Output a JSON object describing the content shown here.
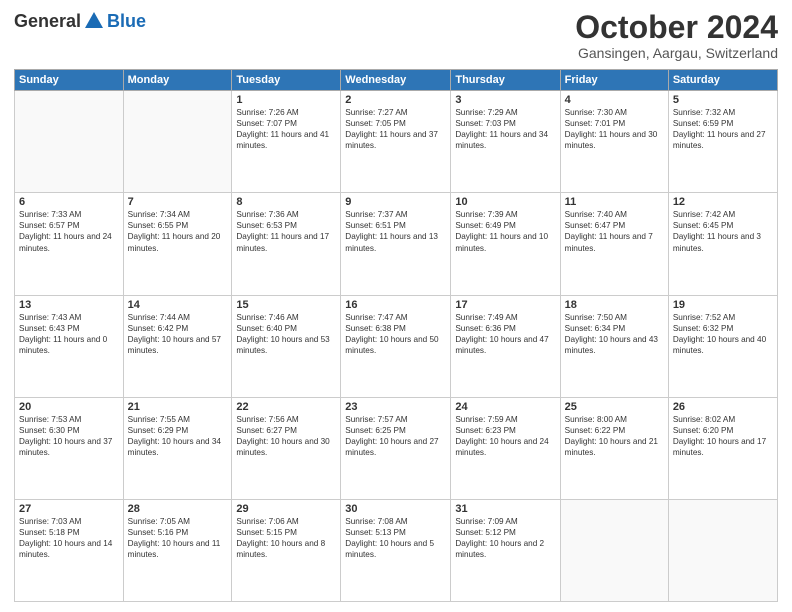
{
  "header": {
    "logo_general": "General",
    "logo_blue": "Blue",
    "month_title": "October 2024",
    "subtitle": "Gansingen, Aargau, Switzerland"
  },
  "days_of_week": [
    "Sunday",
    "Monday",
    "Tuesday",
    "Wednesday",
    "Thursday",
    "Friday",
    "Saturday"
  ],
  "weeks": [
    [
      {
        "day": "",
        "info": ""
      },
      {
        "day": "",
        "info": ""
      },
      {
        "day": "1",
        "info": "Sunrise: 7:26 AM\nSunset: 7:07 PM\nDaylight: 11 hours and 41 minutes."
      },
      {
        "day": "2",
        "info": "Sunrise: 7:27 AM\nSunset: 7:05 PM\nDaylight: 11 hours and 37 minutes."
      },
      {
        "day": "3",
        "info": "Sunrise: 7:29 AM\nSunset: 7:03 PM\nDaylight: 11 hours and 34 minutes."
      },
      {
        "day": "4",
        "info": "Sunrise: 7:30 AM\nSunset: 7:01 PM\nDaylight: 11 hours and 30 minutes."
      },
      {
        "day": "5",
        "info": "Sunrise: 7:32 AM\nSunset: 6:59 PM\nDaylight: 11 hours and 27 minutes."
      }
    ],
    [
      {
        "day": "6",
        "info": "Sunrise: 7:33 AM\nSunset: 6:57 PM\nDaylight: 11 hours and 24 minutes."
      },
      {
        "day": "7",
        "info": "Sunrise: 7:34 AM\nSunset: 6:55 PM\nDaylight: 11 hours and 20 minutes."
      },
      {
        "day": "8",
        "info": "Sunrise: 7:36 AM\nSunset: 6:53 PM\nDaylight: 11 hours and 17 minutes."
      },
      {
        "day": "9",
        "info": "Sunrise: 7:37 AM\nSunset: 6:51 PM\nDaylight: 11 hours and 13 minutes."
      },
      {
        "day": "10",
        "info": "Sunrise: 7:39 AM\nSunset: 6:49 PM\nDaylight: 11 hours and 10 minutes."
      },
      {
        "day": "11",
        "info": "Sunrise: 7:40 AM\nSunset: 6:47 PM\nDaylight: 11 hours and 7 minutes."
      },
      {
        "day": "12",
        "info": "Sunrise: 7:42 AM\nSunset: 6:45 PM\nDaylight: 11 hours and 3 minutes."
      }
    ],
    [
      {
        "day": "13",
        "info": "Sunrise: 7:43 AM\nSunset: 6:43 PM\nDaylight: 11 hours and 0 minutes."
      },
      {
        "day": "14",
        "info": "Sunrise: 7:44 AM\nSunset: 6:42 PM\nDaylight: 10 hours and 57 minutes."
      },
      {
        "day": "15",
        "info": "Sunrise: 7:46 AM\nSunset: 6:40 PM\nDaylight: 10 hours and 53 minutes."
      },
      {
        "day": "16",
        "info": "Sunrise: 7:47 AM\nSunset: 6:38 PM\nDaylight: 10 hours and 50 minutes."
      },
      {
        "day": "17",
        "info": "Sunrise: 7:49 AM\nSunset: 6:36 PM\nDaylight: 10 hours and 47 minutes."
      },
      {
        "day": "18",
        "info": "Sunrise: 7:50 AM\nSunset: 6:34 PM\nDaylight: 10 hours and 43 minutes."
      },
      {
        "day": "19",
        "info": "Sunrise: 7:52 AM\nSunset: 6:32 PM\nDaylight: 10 hours and 40 minutes."
      }
    ],
    [
      {
        "day": "20",
        "info": "Sunrise: 7:53 AM\nSunset: 6:30 PM\nDaylight: 10 hours and 37 minutes."
      },
      {
        "day": "21",
        "info": "Sunrise: 7:55 AM\nSunset: 6:29 PM\nDaylight: 10 hours and 34 minutes."
      },
      {
        "day": "22",
        "info": "Sunrise: 7:56 AM\nSunset: 6:27 PM\nDaylight: 10 hours and 30 minutes."
      },
      {
        "day": "23",
        "info": "Sunrise: 7:57 AM\nSunset: 6:25 PM\nDaylight: 10 hours and 27 minutes."
      },
      {
        "day": "24",
        "info": "Sunrise: 7:59 AM\nSunset: 6:23 PM\nDaylight: 10 hours and 24 minutes."
      },
      {
        "day": "25",
        "info": "Sunrise: 8:00 AM\nSunset: 6:22 PM\nDaylight: 10 hours and 21 minutes."
      },
      {
        "day": "26",
        "info": "Sunrise: 8:02 AM\nSunset: 6:20 PM\nDaylight: 10 hours and 17 minutes."
      }
    ],
    [
      {
        "day": "27",
        "info": "Sunrise: 7:03 AM\nSunset: 5:18 PM\nDaylight: 10 hours and 14 minutes."
      },
      {
        "day": "28",
        "info": "Sunrise: 7:05 AM\nSunset: 5:16 PM\nDaylight: 10 hours and 11 minutes."
      },
      {
        "day": "29",
        "info": "Sunrise: 7:06 AM\nSunset: 5:15 PM\nDaylight: 10 hours and 8 minutes."
      },
      {
        "day": "30",
        "info": "Sunrise: 7:08 AM\nSunset: 5:13 PM\nDaylight: 10 hours and 5 minutes."
      },
      {
        "day": "31",
        "info": "Sunrise: 7:09 AM\nSunset: 5:12 PM\nDaylight: 10 hours and 2 minutes."
      },
      {
        "day": "",
        "info": ""
      },
      {
        "day": "",
        "info": ""
      }
    ]
  ]
}
